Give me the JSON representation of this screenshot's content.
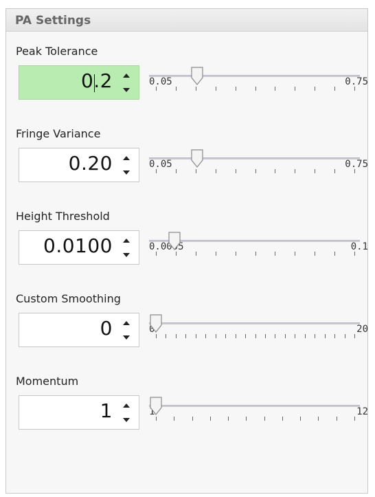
{
  "panel": {
    "title": "PA Settings"
  },
  "settings": [
    {
      "label": "Peak Tolerance",
      "value": "0.2",
      "active": true,
      "min_label": "0.05",
      "max_label": "0.75",
      "level": 0.21,
      "ticks": 11
    },
    {
      "label": "Fringe Variance",
      "value": "0.20",
      "active": false,
      "min_label": "0.05",
      "max_label": "0.75",
      "level": 0.21,
      "ticks": 11
    },
    {
      "label": "Height Threshold",
      "value": "0.0100",
      "active": false,
      "min_label": "0.0005",
      "max_label": "0.1",
      "level": 0.095,
      "ticks": 11
    },
    {
      "label": "Custom Smoothing",
      "value": "0",
      "active": false,
      "min_label": "0",
      "max_label": "20",
      "level": 0.0,
      "ticks": 21
    },
    {
      "label": "Momentum",
      "value": "1",
      "active": false,
      "min_label": "1",
      "max_label": "12",
      "level": 0.0,
      "ticks": 12
    }
  ],
  "icons": {
    "up": "spin-up-icon",
    "down": "spin-down-icon"
  },
  "colors": {
    "active_input": "#b9ecb0",
    "panel_bg": "#f7f7f7"
  }
}
